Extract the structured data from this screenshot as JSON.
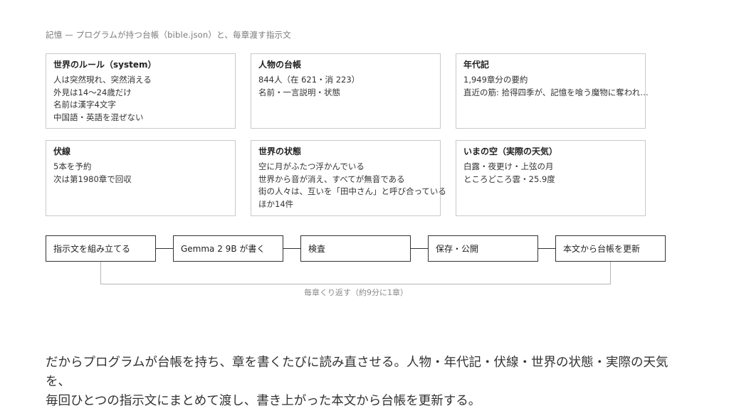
{
  "caption": "記憶 — プログラムが持つ台帳（bible.json）と、毎章渡す指示文",
  "cards": [
    {
      "title": "世界のルール（system）",
      "lines": [
        "人は突然現れ、突然消える",
        "外見は14〜24歳だけ",
        "名前は漢字4文字",
        "中国語・英語を混ぜない"
      ]
    },
    {
      "title": "人物の台帳",
      "lines": [
        "844人（在 621・消 223）",
        "名前・一言説明・状態"
      ]
    },
    {
      "title": "年代記",
      "lines": [
        "1,949章分の要約",
        "直近の筋: 拾得四季が、記憶を喰う魔物に奪われ…"
      ]
    },
    {
      "title": "伏線",
      "lines": [
        "5本を予約",
        "次は第1980章で回収"
      ]
    },
    {
      "title": "世界の状態",
      "lines": [
        "空に月がふたつ浮かんでいる",
        "世界から音が消え、すべてが無音である",
        "街の人々は、互いを「田中さん」と呼び合っている",
        "ほか14件"
      ]
    },
    {
      "title": "いまの空（実際の天気）",
      "lines": [
        "白露・夜更け・上弦の月",
        "ところどころ雲・25.9度"
      ]
    }
  ],
  "pipeline": {
    "steps": [
      "指示文を組み立てる",
      "Gemma 2 9B が書く",
      "検査",
      "保存・公開",
      "本文から台帳を更新"
    ],
    "loop_label": "毎章くり返す（約9分に1章）"
  },
  "summary": {
    "line1": "だからプログラムが台帳を持ち、章を書くたびに読み直させる。人物・年代記・伏線・世界の状態・実際の天気を、",
    "line2": "毎回ひとつの指示文にまとめて渡し、書き上がった本文から台帳を更新する。"
  }
}
